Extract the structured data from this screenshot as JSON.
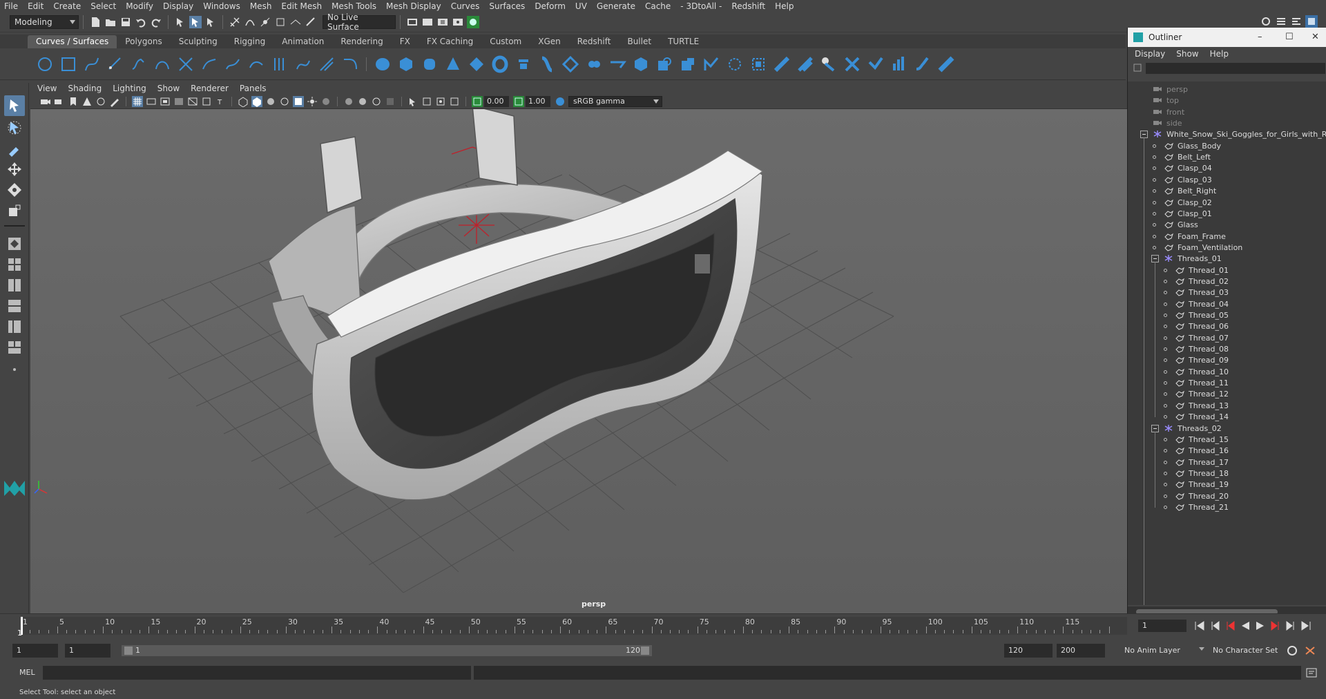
{
  "menubar": [
    "File",
    "Edit",
    "Create",
    "Select",
    "Modify",
    "Display",
    "Windows",
    "Mesh",
    "Edit Mesh",
    "Mesh Tools",
    "Mesh Display",
    "Curves",
    "Surfaces",
    "Deform",
    "UV",
    "Generate",
    "Cache",
    "- 3DtoAll -",
    "Redshift",
    "Help"
  ],
  "statusline": {
    "mode": "Modeling",
    "live_surface": "No Live Surface"
  },
  "shelf_tabs": [
    "Curves / Surfaces",
    "Polygons",
    "Sculpting",
    "Rigging",
    "Animation",
    "Rendering",
    "FX",
    "FX Caching",
    "Custom",
    "XGen",
    "Redshift",
    "Bullet",
    "TURTLE"
  ],
  "viewport": {
    "menu": [
      "View",
      "Shading",
      "Lighting",
      "Show",
      "Renderer",
      "Panels"
    ],
    "exposure": "0.00",
    "gamma": "1.00",
    "color_space": "sRGB gamma",
    "camera_label": "persp"
  },
  "outliner": {
    "title": "Outliner",
    "menu": [
      "Display",
      "Show",
      "Help"
    ],
    "rows": [
      {
        "label": "persp",
        "type": "camera",
        "depth": 0
      },
      {
        "label": "top",
        "type": "camera",
        "depth": 0
      },
      {
        "label": "front",
        "type": "camera",
        "depth": 0
      },
      {
        "label": "side",
        "type": "camera",
        "depth": 0
      },
      {
        "label": "White_Snow_Ski_Goggles_for_Girls_with_R",
        "type": "group",
        "depth": 0,
        "expanded": true
      },
      {
        "label": "Glass_Body",
        "type": "mesh",
        "depth": 1
      },
      {
        "label": "Belt_Left",
        "type": "mesh",
        "depth": 1
      },
      {
        "label": "Clasp_04",
        "type": "mesh",
        "depth": 1
      },
      {
        "label": "Clasp_03",
        "type": "mesh",
        "depth": 1
      },
      {
        "label": "Belt_Right",
        "type": "mesh",
        "depth": 1
      },
      {
        "label": "Clasp_02",
        "type": "mesh",
        "depth": 1
      },
      {
        "label": "Clasp_01",
        "type": "mesh",
        "depth": 1
      },
      {
        "label": "Glass",
        "type": "mesh",
        "depth": 1
      },
      {
        "label": "Foam_Frame",
        "type": "mesh",
        "depth": 1
      },
      {
        "label": "Foam_Ventilation",
        "type": "mesh",
        "depth": 1
      },
      {
        "label": "Threads_01",
        "type": "group",
        "depth": 1,
        "expanded": true
      },
      {
        "label": "Thread_01",
        "type": "mesh",
        "depth": 2
      },
      {
        "label": "Thread_02",
        "type": "mesh",
        "depth": 2
      },
      {
        "label": "Thread_03",
        "type": "mesh",
        "depth": 2
      },
      {
        "label": "Thread_04",
        "type": "mesh",
        "depth": 2
      },
      {
        "label": "Thread_05",
        "type": "mesh",
        "depth": 2
      },
      {
        "label": "Thread_06",
        "type": "mesh",
        "depth": 2
      },
      {
        "label": "Thread_07",
        "type": "mesh",
        "depth": 2
      },
      {
        "label": "Thread_08",
        "type": "mesh",
        "depth": 2
      },
      {
        "label": "Thread_09",
        "type": "mesh",
        "depth": 2
      },
      {
        "label": "Thread_10",
        "type": "mesh",
        "depth": 2
      },
      {
        "label": "Thread_11",
        "type": "mesh",
        "depth": 2
      },
      {
        "label": "Thread_12",
        "type": "mesh",
        "depth": 2
      },
      {
        "label": "Thread_13",
        "type": "mesh",
        "depth": 2
      },
      {
        "label": "Thread_14",
        "type": "mesh",
        "depth": 2
      },
      {
        "label": "Threads_02",
        "type": "group",
        "depth": 1,
        "expanded": true
      },
      {
        "label": "Thread_15",
        "type": "mesh",
        "depth": 2
      },
      {
        "label": "Thread_16",
        "type": "mesh",
        "depth": 2
      },
      {
        "label": "Thread_17",
        "type": "mesh",
        "depth": 2
      },
      {
        "label": "Thread_18",
        "type": "mesh",
        "depth": 2
      },
      {
        "label": "Thread_19",
        "type": "mesh",
        "depth": 2
      },
      {
        "label": "Thread_20",
        "type": "mesh",
        "depth": 2
      },
      {
        "label": "Thread_21",
        "type": "mesh",
        "depth": 2
      }
    ]
  },
  "timeslider": {
    "ticks": [
      1,
      5,
      10,
      15,
      20,
      25,
      30,
      35,
      40,
      45,
      50,
      55,
      60,
      65,
      70,
      75,
      80,
      85,
      90,
      95,
      100,
      105,
      110,
      115
    ],
    "current_frame": "1",
    "current_frame_field": "1"
  },
  "range": {
    "start": "1",
    "playback_start": "1",
    "range_start_label": "1",
    "range_end_label": "120",
    "playback_end": "120",
    "end": "200",
    "anim_layer": "No Anim Layer",
    "character_set": "No Character Set"
  },
  "commandline": {
    "lang": "MEL"
  },
  "helpline": "Select Tool: select an object",
  "colors": {
    "accent": "#5a7fa5",
    "shelf_blue": "#3a8fd6",
    "grid_line": "#4a4a4a"
  }
}
